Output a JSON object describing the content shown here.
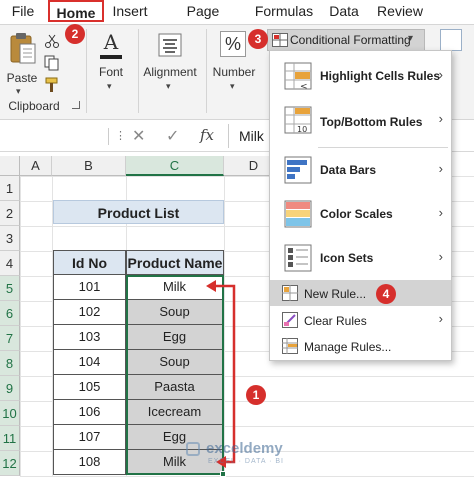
{
  "tabs": [
    "File",
    "Home",
    "Insert",
    "Page Layout",
    "Formulas",
    "Data",
    "Review"
  ],
  "ribbon": {
    "paste_label": "Paste",
    "clipboard_label": "Clipboard",
    "font_label": "Font",
    "alignment_label": "Alignment",
    "number_label": "Number",
    "cf_button_label": "Conditional Formatting"
  },
  "formula_bar": {
    "content": "Milk"
  },
  "columns": [
    "A",
    "B",
    "C",
    "D"
  ],
  "rows": [
    "1",
    "2",
    "3",
    "4",
    "5",
    "6",
    "7",
    "8",
    "9",
    "10",
    "11",
    "12"
  ],
  "table": {
    "title": "Product List",
    "headers": [
      "Id No",
      "Product Name"
    ],
    "ids": [
      "101",
      "102",
      "103",
      "104",
      "105",
      "106",
      "107",
      "108"
    ],
    "names": [
      "Milk",
      "Soup",
      "Egg",
      "Soup",
      "Paasta",
      "Icecream",
      "Egg",
      "Milk"
    ]
  },
  "menu": {
    "highlight": "Highlight Cells Rules",
    "topbottom": "Top/Bottom Rules",
    "databars": "Data Bars",
    "colorscales": "Color Scales",
    "iconsets": "Icon Sets",
    "newrule": "New Rule...",
    "clearrules": "Clear Rules",
    "managerules": "Manage Rules..."
  },
  "badges": [
    "1",
    "2",
    "3",
    "4"
  ],
  "watermark": {
    "name": "exceldemy",
    "tagline": "EXCEL · DATA · BI"
  },
  "colors": {
    "accent_red": "#d62f2c",
    "selection_fill": "#d3d3d3",
    "header_fill": "#dce6f1",
    "excel_green": "#217346"
  }
}
